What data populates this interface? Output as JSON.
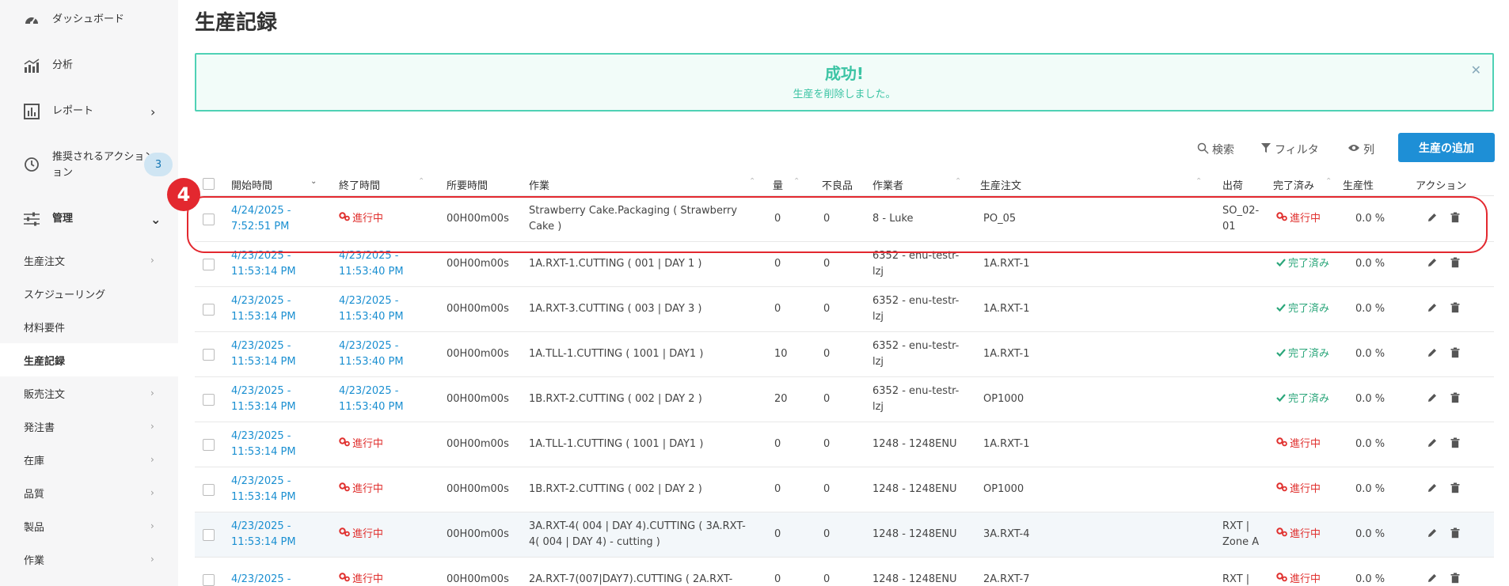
{
  "sidebar": {
    "top_items": [
      {
        "label": "ダッシュボード",
        "icon": "dashboard-icon"
      },
      {
        "label": "分析",
        "icon": "analytics-icon"
      },
      {
        "label": "レポート",
        "icon": "report-icon"
      },
      {
        "label": "推奨されるアクション",
        "label2": "ョン",
        "icon": "history-icon",
        "badge": "3"
      },
      {
        "label": "管理",
        "icon": "sliders-icon"
      }
    ],
    "sub_items": [
      "生産注文",
      "スケジューリング",
      "材料要件",
      "生産記録",
      "販売注文",
      "発注書",
      "在庫",
      "品質",
      "製品",
      "作業"
    ]
  },
  "page": {
    "title": "生産記録",
    "alert_title": "成功!",
    "alert_message": "生産を削除しました。"
  },
  "toolbar": {
    "search": "検索",
    "filter": "フィルタ",
    "columns": "列",
    "add": "生産の追加"
  },
  "table": {
    "headers": [
      "開始時間",
      "終了時間",
      "所要時間",
      "作業",
      "量",
      "不良品",
      "作業者",
      "生産注文",
      "出荷",
      "完了済み",
      "生産性",
      "アクション"
    ],
    "rows": [
      {
        "start1": "4/24/2025 -",
        "start2": "7:52:51 PM",
        "end1": "進行中",
        "end2": "",
        "end_prog": true,
        "duration": "00H00m00s",
        "task1": "Strawberry Cake.Packaging ( Strawberry",
        "task2": "Cake )",
        "qty": "0",
        "defect": "0",
        "worker1": "8 - Luke",
        "worker2": "",
        "order": "PO_05",
        "ship1": "SO_02-",
        "ship2": "01",
        "status": "進行中",
        "status_prog": true,
        "prod": "0.0 %"
      },
      {
        "start1": "4/23/2025 -",
        "start2": "11:53:14 PM",
        "end1": "4/23/2025 -",
        "end2": "11:53:40 PM",
        "end_prog": false,
        "duration": "00H00m00s",
        "task1": "1A.RXT-1.CUTTING ( 001 | DAY 1 )",
        "task2": "",
        "qty": "0",
        "defect": "0",
        "worker1": "6352 - enu-testr-",
        "worker2": "lzj",
        "order": "1A.RXT-1",
        "ship1": "",
        "ship2": "",
        "status": "完了済み",
        "status_prog": false,
        "prod": "0.0 %"
      },
      {
        "start1": "4/23/2025 -",
        "start2": "11:53:14 PM",
        "end1": "4/23/2025 -",
        "end2": "11:53:40 PM",
        "end_prog": false,
        "duration": "00H00m00s",
        "task1": "1A.RXT-3.CUTTING ( 003 | DAY 3 )",
        "task2": "",
        "qty": "0",
        "defect": "0",
        "worker1": "6352 - enu-testr-",
        "worker2": "lzj",
        "order": "1A.RXT-1",
        "ship1": "",
        "ship2": "",
        "status": "完了済み",
        "status_prog": false,
        "prod": "0.0 %"
      },
      {
        "start1": "4/23/2025 -",
        "start2": "11:53:14 PM",
        "end1": "4/23/2025 -",
        "end2": "11:53:40 PM",
        "end_prog": false,
        "duration": "00H00m00s",
        "task1": "1A.TLL-1.CUTTING ( 1001 | DAY1 )",
        "task2": "",
        "qty": "10",
        "defect": "0",
        "worker1": "6352 - enu-testr-",
        "worker2": "lzj",
        "order": "1A.RXT-1",
        "ship1": "",
        "ship2": "",
        "status": "完了済み",
        "status_prog": false,
        "prod": "0.0 %"
      },
      {
        "start1": "4/23/2025 -",
        "start2": "11:53:14 PM",
        "end1": "4/23/2025 -",
        "end2": "11:53:40 PM",
        "end_prog": false,
        "duration": "00H00m00s",
        "task1": "1B.RXT-2.CUTTING ( 002 | DAY 2 )",
        "task2": "",
        "qty": "20",
        "defect": "0",
        "worker1": "6352 - enu-testr-",
        "worker2": "lzj",
        "order": "OP1000",
        "ship1": "",
        "ship2": "",
        "status": "完了済み",
        "status_prog": false,
        "prod": "0.0 %"
      },
      {
        "start1": "4/23/2025 -",
        "start2": "11:53:14 PM",
        "end1": "進行中",
        "end2": "",
        "end_prog": true,
        "duration": "00H00m00s",
        "task1": "1A.TLL-1.CUTTING ( 1001 | DAY1 )",
        "task2": "",
        "qty": "0",
        "defect": "0",
        "worker1": "1248 - 1248ENU",
        "worker2": "",
        "order": "1A.RXT-1",
        "ship1": "",
        "ship2": "",
        "status": "進行中",
        "status_prog": true,
        "prod": "0.0 %"
      },
      {
        "start1": "4/23/2025 -",
        "start2": "11:53:14 PM",
        "end1": "進行中",
        "end2": "",
        "end_prog": true,
        "duration": "00H00m00s",
        "task1": "1B.RXT-2.CUTTING ( 002 | DAY 2 )",
        "task2": "",
        "qty": "0",
        "defect": "0",
        "worker1": "1248 - 1248ENU",
        "worker2": "",
        "order": "OP1000",
        "ship1": "",
        "ship2": "",
        "status": "進行中",
        "status_prog": true,
        "prod": "0.0 %"
      },
      {
        "start1": "4/23/2025 -",
        "start2": "11:53:14 PM",
        "end1": "進行中",
        "end2": "",
        "end_prog": true,
        "duration": "00H00m00s",
        "task1": "3A.RXT-4( 004 | DAY 4).CUTTING ( 3A.RXT-",
        "task2": "4( 004 | DAY 4) - cutting )",
        "qty": "0",
        "defect": "0",
        "worker1": "1248 - 1248ENU",
        "worker2": "",
        "order": "3A.RXT-4",
        "ship1": "RXT |",
        "ship2": "Zone A",
        "status": "進行中",
        "status_prog": true,
        "prod": "0.0 %"
      },
      {
        "start1": "4/23/2025 -",
        "start2": "",
        "end1": "進行中",
        "end2": "",
        "end_prog": true,
        "duration": "00H00m00s",
        "task1": "2A.RXT-7(007|DAY7).CUTTING ( 2A.RXT-",
        "task2": "",
        "qty": "0",
        "defect": "0",
        "worker1": "1248 - 1248ENU",
        "worker2": "",
        "order": "2A.RXT-7",
        "ship1": "RXT |",
        "ship2": "",
        "status": "進行中",
        "status_prog": true,
        "prod": "0.0 %"
      }
    ]
  },
  "annotation": {
    "step": "4"
  },
  "colors": {
    "accent": "#1e8fd6",
    "success": "#3cc4a4",
    "danger": "#e0302e",
    "done": "#2aa67a"
  }
}
